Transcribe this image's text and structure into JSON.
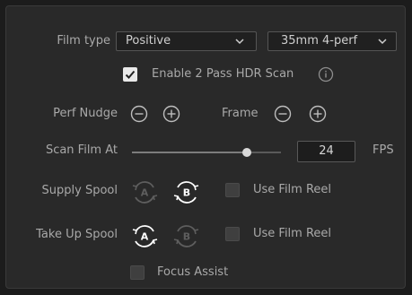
{
  "film_type": {
    "label": "Film type",
    "type_value": "Positive",
    "format_value": "35mm 4-perf"
  },
  "hdr_scan": {
    "label": "Enable 2 Pass HDR Scan",
    "checked": true,
    "info_icon": "info-icon"
  },
  "perf_nudge": {
    "label": "Perf Nudge",
    "minus_icon": "minus-circle-icon",
    "plus_icon": "plus-circle-icon"
  },
  "frame": {
    "label": "Frame",
    "minus_icon": "minus-circle-icon",
    "plus_icon": "plus-circle-icon"
  },
  "scan_film": {
    "label": "Scan Film At",
    "fps_value": "24",
    "unit": "FPS",
    "slider_fraction": 0.77
  },
  "supply_spool": {
    "label": "Supply Spool",
    "spool_a_active": false,
    "spool_b_active": true,
    "use_film_reel_label": "Use Film Reel",
    "use_film_reel_checked": false
  },
  "take_up_spool": {
    "label": "Take Up Spool",
    "spool_a_active": true,
    "spool_b_active": false,
    "use_film_reel_label": "Use Film Reel",
    "use_film_reel_checked": false
  },
  "focus_assist": {
    "label": "Focus Assist",
    "checked": false
  },
  "colors": {
    "panel_bg": "#292929",
    "text": "#a9a9a9",
    "active_icon": "#ffffff",
    "inactive_icon": "#5e5e5e"
  }
}
